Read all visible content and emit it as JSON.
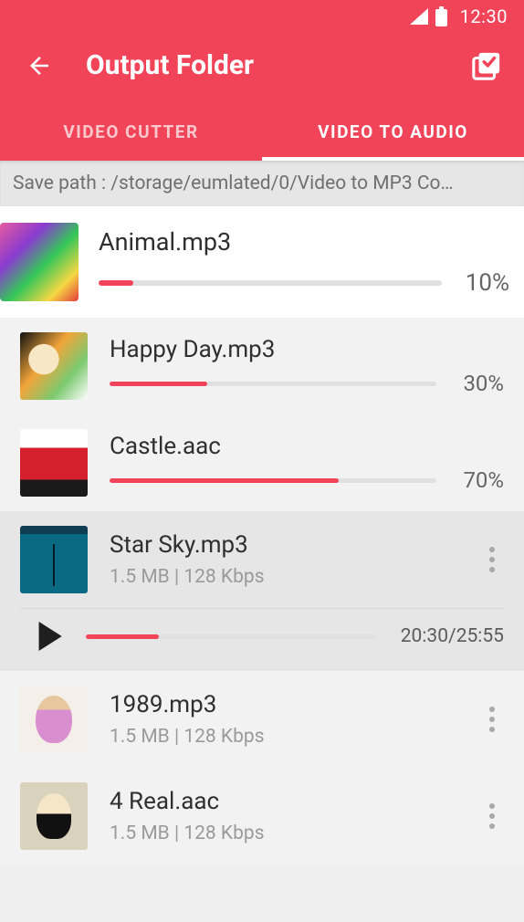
{
  "status": {
    "time": "12:30"
  },
  "header": {
    "title": "Output Folder",
    "tabs": {
      "cutter": "VIDEO CUTTER",
      "toaudio": "VIDEO TO AUDIO"
    }
  },
  "save_path": "Save path : /storage/eumlated/0/Video to MP3 Co…",
  "featured": {
    "name": "Animal.mp3",
    "progress": 10,
    "pct_label": "10%"
  },
  "player": {
    "position_label": "20:30/25:55",
    "progress": 25
  },
  "items": [
    {
      "name": "Happy Day.mp3",
      "progress": 30,
      "pct_label": "30%"
    },
    {
      "name": "Castle.aac",
      "progress": 70,
      "pct_label": "70%"
    },
    {
      "name": "Star Sky.mp3",
      "meta": "1.5 MB | 128 Kbps",
      "selected": true
    },
    {
      "name": "1989.mp3",
      "meta": "1.5 MB | 128 Kbps"
    },
    {
      "name": "4 Real.aac",
      "meta": "1.5 MB | 128 Kbps"
    }
  ]
}
